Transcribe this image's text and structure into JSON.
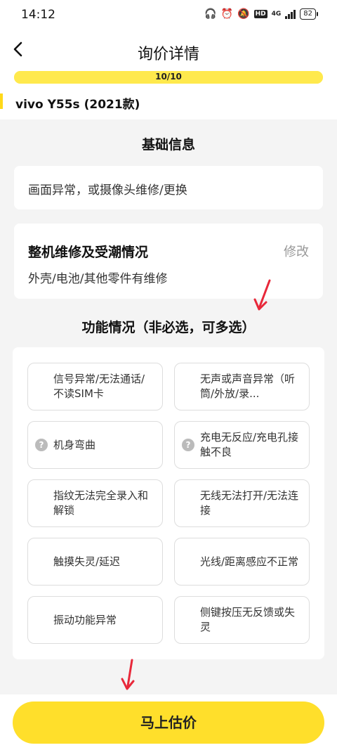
{
  "status_bar": {
    "time": "14:12",
    "hd": "HD",
    "network": "4G",
    "battery": "82"
  },
  "nav": {
    "back_icon": "‹",
    "title": "询价详情"
  },
  "progress": {
    "label": "10/10",
    "fraction": 1.0
  },
  "model": "vivo Y55s (2021款)",
  "basic_info": {
    "title": "基础信息",
    "screen_card": {
      "value": "画面异常，或摄像头维修/更换"
    },
    "repair_card": {
      "heading": "整机维修及受潮情况",
      "edit_label": "修改",
      "value": "外壳/电池/其他零件有维修"
    }
  },
  "function": {
    "title": "功能情况（非必选，可多选）",
    "options": [
      {
        "label": "信号异常/无法通话/不读SIM卡",
        "has_help": false
      },
      {
        "label": "无声或声音异常（听筒/外放/录...",
        "has_help": false
      },
      {
        "label": "机身弯曲",
        "has_help": true
      },
      {
        "label": "充电无反应/充电孔接触不良",
        "has_help": true
      },
      {
        "label": "指纹无法完全录入和解锁",
        "has_help": false
      },
      {
        "label": "无线无法打开/无法连接",
        "has_help": false
      },
      {
        "label": "触摸失灵/延迟",
        "has_help": false
      },
      {
        "label": "光线/距离感应不正常",
        "has_help": false
      },
      {
        "label": "振动功能异常",
        "has_help": false
      },
      {
        "label": "侧键按压无反馈或失灵",
        "has_help": false
      }
    ]
  },
  "cta": {
    "label": "马上估价"
  },
  "colors": {
    "accent": "#ffdf2b",
    "arrow": "#e8283a"
  }
}
